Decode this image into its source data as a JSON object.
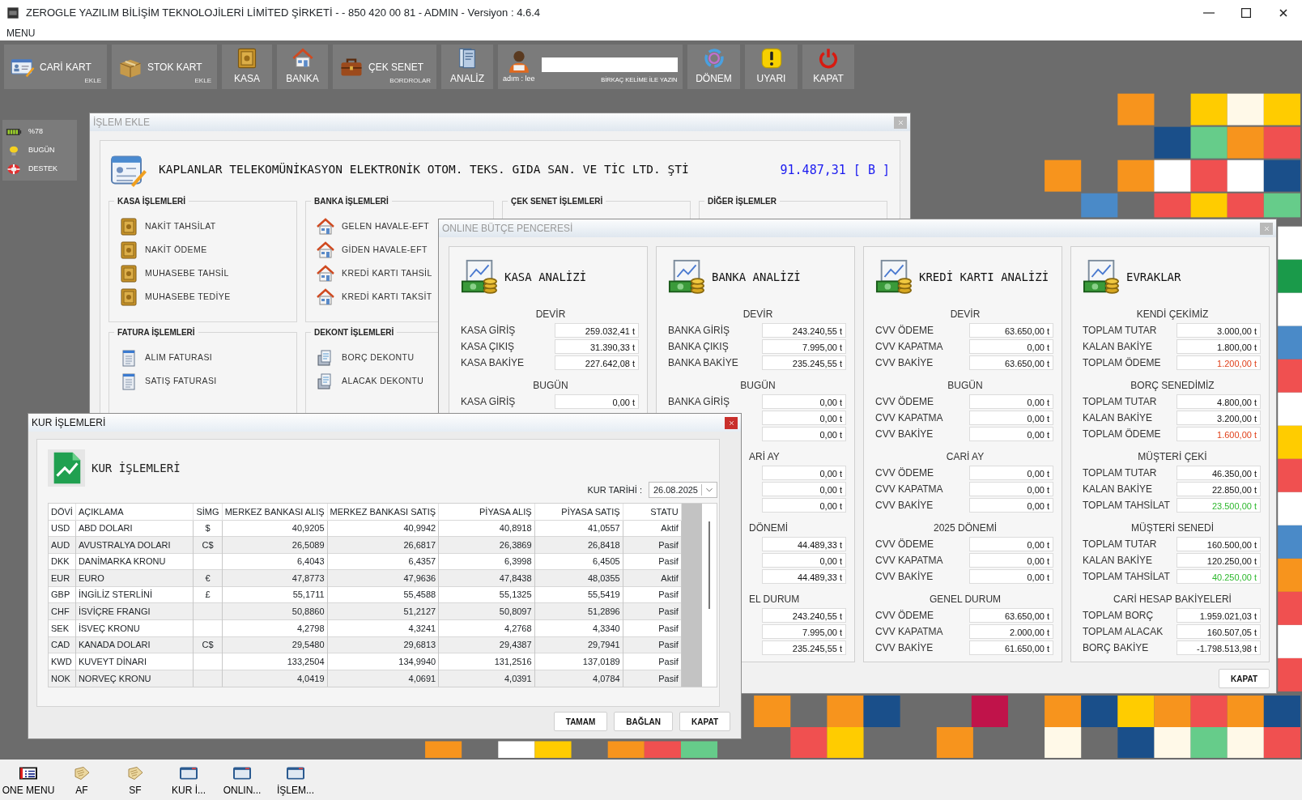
{
  "window": {
    "title": "ZEROGLE YAZILIM BİLİŞİM TEKNOLOJİLERİ LİMİTED ŞİRKETİ -  - 850 420 00 81 - ADMIN -  Versiyon : 4.6.4"
  },
  "menu": [
    "MENU"
  ],
  "toolbar": [
    {
      "kind": "wide",
      "label": "CARİ KART",
      "sub": "EKLE"
    },
    {
      "kind": "wide",
      "label": "STOK KART",
      "sub": "EKLE"
    },
    {
      "kind": "tile",
      "label": "KASA"
    },
    {
      "kind": "tile",
      "label": "BANKA"
    },
    {
      "kind": "wide",
      "label": "ÇEK SENET",
      "sub": "BORDROLAR"
    },
    {
      "kind": "tile",
      "label": "ANALİZ"
    },
    {
      "kind": "search",
      "user": "adım : lee",
      "hint": "BİRKAÇ KELİME İLE YAZIN"
    },
    {
      "kind": "tile",
      "label": "DÖNEM"
    },
    {
      "kind": "tile",
      "label": "UYARI"
    },
    {
      "kind": "tile",
      "label": "KAPAT"
    }
  ],
  "sidebar": [
    "%78",
    "BUGÜN",
    "DESTEK"
  ],
  "islem_ekle": {
    "title": "İŞLEM EKLE",
    "company": "KAPLANLAR TELEKOMÜNİKASYON ELEKTRONİK OTOM. TEKS. GIDA SAN. VE TİC LTD. ŞTİ",
    "balance": "91.487,31 [ B ]",
    "groups": [
      {
        "title": "KASA İŞLEMLERİ",
        "items": [
          "NAKİT TAHSİLAT",
          "NAKİT ÖDEME",
          "MUHASEBE TAHSİL",
          "MUHASEBE TEDİYE"
        ]
      },
      {
        "title": "BANKA İŞLEMLERİ",
        "items": [
          "GELEN HAVALE-EFT",
          "GİDEN HAVALE-EFT",
          "KREDİ KARTI TAHSİL",
          "KREDİ KARTI TAKSİT"
        ]
      },
      {
        "title": "ÇEK SENET İŞLEMLERİ"
      },
      {
        "title": "DİĞER İŞLEMLER"
      },
      {
        "title": "FATURA İŞLEMLERİ",
        "items": [
          "ALIM FATURASI",
          "SATIŞ FATURASI"
        ]
      },
      {
        "title": "DEKONT İŞLEMLERİ",
        "items": [
          "BORÇ DEKONTU",
          "ALACAK DEKONTU"
        ]
      }
    ]
  },
  "online_butce": {
    "title": "ONLINE BÜTÇE PENCERESİ",
    "close_label": "KAPAT",
    "panels": [
      {
        "title": "KASA ANALİZİ",
        "sections": [
          {
            "kind": "full",
            "header": "DEVİR",
            "rows": [
              {
                "label": "KASA GİRİŞ",
                "value": "259.032,41 t"
              },
              {
                "label": "KASA ÇIKIŞ",
                "value": "31.390,33 t"
              },
              {
                "label": "KASA BAKİYE",
                "value": "227.642,08 t"
              }
            ]
          },
          {
            "kind": "full",
            "header": "BUGÜN",
            "rows": [
              {
                "label": "KASA GİRİŞ",
                "value": "0,00 t"
              }
            ]
          }
        ]
      },
      {
        "title": "BANKA ANALİZİ",
        "sections": [
          {
            "kind": "full",
            "header": "DEVİR",
            "rows": [
              {
                "label": "BANKA GİRİŞ",
                "value": "243.240,55 t"
              },
              {
                "label": "BANKA ÇIKIŞ",
                "value": "7.995,00 t"
              },
              {
                "label": "BANKA BAKİYE",
                "value": "235.245,55 t"
              }
            ]
          },
          {
            "kind": "full",
            "header": "BUGÜN",
            "rows": [
              {
                "label": "BANKA GİRİŞ",
                "value": "0,00 t"
              },
              {
                "value": "0,00 t"
              },
              {
                "value": "0,00 t"
              }
            ]
          },
          {
            "kind": "clipped",
            "header": "ARİ AY",
            "rows": [
              {
                "value": "0,00 t"
              },
              {
                "value": "0,00 t"
              },
              {
                "value": "0,00 t"
              }
            ]
          },
          {
            "kind": "clipped",
            "header": "DÖNEMİ",
            "rows": [
              {
                "value": "44.489,33 t"
              },
              {
                "value": "0,00 t"
              },
              {
                "value": "44.489,33 t"
              }
            ]
          },
          {
            "kind": "clipped",
            "header": "EL DURUM",
            "rows": [
              {
                "value": "243.240,55 t"
              },
              {
                "value": "7.995,00 t"
              },
              {
                "value": "235.245,55 t"
              }
            ]
          }
        ]
      },
      {
        "title": "KREDİ KARTI ANALİZİ",
        "sections": [
          {
            "kind": "full",
            "header": "DEVİR",
            "rows": [
              {
                "label": "CVV ÖDEME",
                "value": "63.650,00 t"
              },
              {
                "label": "CVV KAPATMA",
                "value": "0,00 t"
              },
              {
                "label": "CVV BAKİYE",
                "value": "63.650,00 t"
              }
            ]
          },
          {
            "kind": "full",
            "header": "BUGÜN",
            "rows": [
              {
                "label": "CVV ÖDEME",
                "value": "0,00 t"
              },
              {
                "label": "CVV KAPATMA",
                "value": "0,00 t"
              },
              {
                "label": "CVV BAKİYE",
                "value": "0,00 t"
              }
            ]
          },
          {
            "kind": "full",
            "header": "CARİ AY",
            "rows": [
              {
                "label": "CVV ÖDEME",
                "value": "0,00 t"
              },
              {
                "label": "CVV KAPATMA",
                "value": "0,00 t"
              },
              {
                "label": "CVV BAKİYE",
                "value": "0,00 t"
              }
            ]
          },
          {
            "kind": "full",
            "header": "2025 DÖNEMİ",
            "rows": [
              {
                "label": "CVV ÖDEME",
                "value": "0,00 t"
              },
              {
                "label": "CVV KAPATMA",
                "value": "0,00 t"
              },
              {
                "label": "CVV BAKİYE",
                "value": "0,00 t"
              }
            ]
          },
          {
            "kind": "full",
            "header": "GENEL DURUM",
            "rows": [
              {
                "label": "CVV ÖDEME",
                "value": "63.650,00 t"
              },
              {
                "label": "CVV KAPATMA",
                "value": "2.000,00 t"
              },
              {
                "label": "CVV BAKİYE",
                "value": "61.650,00 t"
              }
            ]
          }
        ]
      },
      {
        "title": "EVRAKLAR",
        "sections": [
          {
            "kind": "full",
            "header": "KENDİ ÇEKİMİZ",
            "rows": [
              {
                "label": "TOPLAM TUTAR",
                "value": "3.000,00 t"
              },
              {
                "label": "KALAN BAKİYE",
                "value": "1.800,00 t"
              },
              {
                "label": "TOPLAM ÖDEME",
                "value": "1.200,00 t",
                "color": "#e0401a"
              }
            ]
          },
          {
            "kind": "full",
            "header": "BORÇ SENEDİMİZ",
            "rows": [
              {
                "label": "TOPLAM TUTAR",
                "value": "4.800,00 t"
              },
              {
                "label": "KALAN BAKİYE",
                "value": "3.200,00 t"
              },
              {
                "label": "TOPLAM ÖDEME",
                "value": "1.600,00 t",
                "color": "#e0401a"
              }
            ]
          },
          {
            "kind": "full",
            "header": "MÜŞTERİ ÇEKİ",
            "rows": [
              {
                "label": "TOPLAM TUTAR",
                "value": "46.350,00 t"
              },
              {
                "label": "KALAN BAKİYE",
                "value": "22.850,00 t"
              },
              {
                "label": "TOPLAM TAHSİLAT",
                "value": "23.500,00 t",
                "color": "#2eb82e"
              }
            ]
          },
          {
            "kind": "full",
            "header": "MÜŞTERİ SENEDİ",
            "rows": [
              {
                "label": "TOPLAM TUTAR",
                "value": "160.500,00 t"
              },
              {
                "label": "KALAN BAKİYE",
                "value": "120.250,00 t"
              },
              {
                "label": "TOPLAM TAHSİLAT",
                "value": "40.250,00 t",
                "color": "#2eb82e"
              }
            ]
          },
          {
            "kind": "full",
            "header": "CARİ HESAP BAKİYELERİ",
            "rows": [
              {
                "label": "TOPLAM BORÇ",
                "value": "1.959.021,03 t"
              },
              {
                "label": "TOPLAM ALACAK",
                "value": "160.507,05 t"
              },
              {
                "label": "BORÇ BAKİYE",
                "value": "-1.798.513,98 t"
              }
            ]
          }
        ]
      }
    ]
  },
  "kur_islemleri": {
    "title": "KUR İŞLEMLERİ",
    "heading": "KUR İŞLEMLERİ",
    "date_label": "KUR TARİHİ :",
    "date": "26.08.2025",
    "table": {
      "columns": [
        "DÖVİ",
        "AÇIKLAMA",
        "SİMG",
        "MERKEZ BANKASI ALIŞ",
        "MERKEZ BANKASI SATIŞ",
        "PİYASA ALIŞ",
        "PİYASA SATIŞ",
        "STATU"
      ],
      "rows": [
        [
          "USD",
          "ABD DOLARI",
          "$",
          "40,9205",
          "40,9942",
          "40,8918",
          "41,0557",
          "Aktif"
        ],
        [
          "AUD",
          "AVUSTRALYA DOLARI",
          "C$",
          "26,5089",
          "26,6817",
          "26,3869",
          "26,8418",
          "Pasif"
        ],
        [
          "DKK",
          "DANİMARKA KRONU",
          "",
          "6,4043",
          "6,4357",
          "6,3998",
          "6,4505",
          "Pasif"
        ],
        [
          "EUR",
          "EURO",
          "€",
          "47,8773",
          "47,9636",
          "47,8438",
          "48,0355",
          "Aktif"
        ],
        [
          "GBP",
          "İNGİLİZ STERLİNİ",
          "£",
          "55,1711",
          "55,4588",
          "55,1325",
          "55,5419",
          "Pasif"
        ],
        [
          "CHF",
          "İSVİÇRE FRANGI",
          "",
          "50,8860",
          "51,2127",
          "50,8097",
          "51,2896",
          "Pasif"
        ],
        [
          "SEK",
          "İSVEÇ KRONU",
          "",
          "4,2798",
          "4,3241",
          "4,2768",
          "4,3340",
          "Pasif"
        ],
        [
          "CAD",
          "KANADA DOLARI",
          "C$",
          "29,5480",
          "29,6813",
          "29,4387",
          "29,7941",
          "Pasif"
        ],
        [
          "KWD",
          "KUVEYT DİNARI",
          "",
          "133,2504",
          "134,9940",
          "131,2516",
          "137,0189",
          "Pasif"
        ],
        [
          "NOK",
          "NORVEÇ KRONU",
          "",
          "4,0419",
          "4,0691",
          "4,0391",
          "4,0784",
          "Pasif"
        ]
      ]
    },
    "buttons": [
      "TAMAM",
      "BAĞLAN",
      "KAPAT"
    ]
  },
  "taskbar": [
    "ONE MENU",
    "AF",
    "SF",
    "KUR İ...",
    "ONLIN...",
    "İŞLEM..."
  ]
}
